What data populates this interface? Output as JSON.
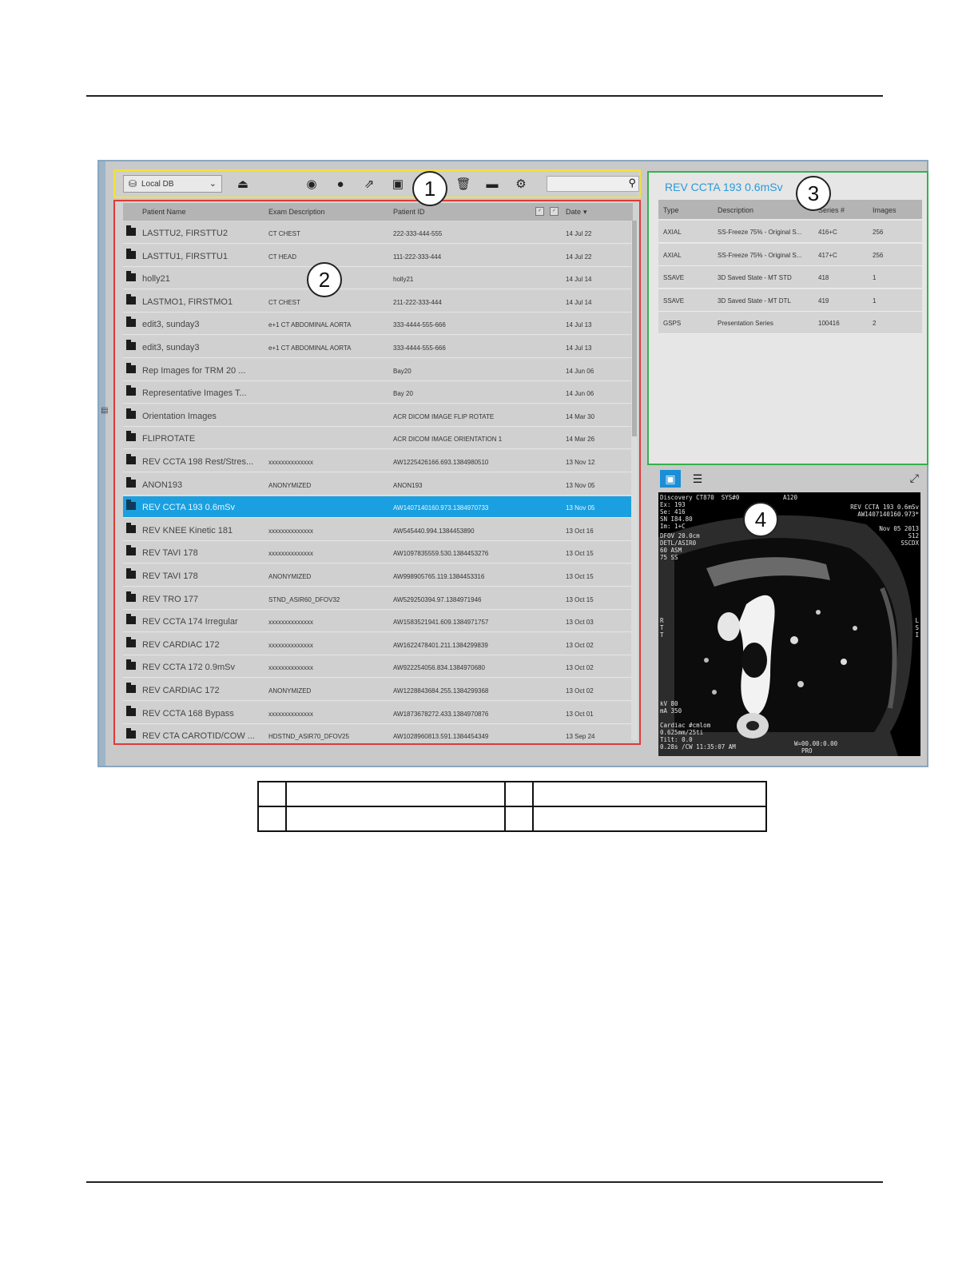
{
  "app": {
    "db_selector": "Local DB",
    "search": {
      "placeholder": ""
    }
  },
  "toolbar": {
    "icons": [
      "database-icon",
      "eject-icon",
      "review-icon",
      "query-icon",
      "export-icon",
      "archive-icon",
      "delete-icon",
      "film-icon",
      "settings-icon",
      "search-icon"
    ]
  },
  "patient_list": {
    "columns": [
      "Patient Name",
      "Exam Description",
      "Patient ID",
      "Date"
    ],
    "rows": [
      {
        "name": "LASTTU2, FIRSTTU2",
        "exam": "CT CHEST",
        "pid": "222-333-444-555",
        "date": "14 Jul 22"
      },
      {
        "name": "LASTTU1, FIRSTTU1",
        "exam": "CT HEAD",
        "pid": "111-222-333-444",
        "date": "14 Jul 22"
      },
      {
        "name": "holly21",
        "exam": "",
        "pid": "holly21",
        "date": "14 Jul 14"
      },
      {
        "name": "LASTMO1, FIRSTMO1",
        "exam": "CT CHEST",
        "pid": "211-222-333-444",
        "date": "14 Jul 14"
      },
      {
        "name": "edit3, sunday3",
        "exam": "e+1 CT ABDOMINAL AORTA",
        "pid": "333-4444-555-666",
        "date": "14 Jul 13"
      },
      {
        "name": "edit3, sunday3",
        "exam": "e+1 CT ABDOMINAL AORTA",
        "pid": "333-4444-555-666",
        "date": "14 Jul 13"
      },
      {
        "name": "Rep Images for TRM 20 ...",
        "exam": "",
        "pid": "Bay20",
        "date": "14 Jun 06"
      },
      {
        "name": "Representative Images T...",
        "exam": "",
        "pid": "Bay 20",
        "date": "14 Jun 06"
      },
      {
        "name": "Orientation Images",
        "exam": "",
        "pid": "ACR DICOM IMAGE FLIP ROTATE",
        "date": "14 Mar 30"
      },
      {
        "name": "FLIPROTATE",
        "exam": "",
        "pid": "ACR DICOM IMAGE ORIENTATION 1",
        "date": "14 Mar 26"
      },
      {
        "name": "REV CCTA 198 Rest/Stres...",
        "exam": "xxxxxxxxxxxxxx",
        "pid": "AW1225426166.693.1384980510",
        "date": "13 Nov 12"
      },
      {
        "name": "ANON193",
        "exam": "ANONYMIZED",
        "pid": "ANON193",
        "date": "13 Nov 05"
      },
      {
        "name": "REV CCTA 193 0.6mSv",
        "exam": "",
        "pid": "AW1407140160.973.1384970733",
        "date": "13 Nov 05",
        "selected": true
      },
      {
        "name": "REV KNEE Kinetic 181",
        "exam": "xxxxxxxxxxxxxx",
        "pid": "AW545440.994.1384453890",
        "date": "13 Oct 16"
      },
      {
        "name": "REV TAVI 178",
        "exam": "xxxxxxxxxxxxxx",
        "pid": "AW1097835559.530.1384453276",
        "date": "13 Oct 15"
      },
      {
        "name": "REV TAVI 178",
        "exam": "ANONYMIZED",
        "pid": "AW998905765.119.1384453316",
        "date": "13 Oct 15"
      },
      {
        "name": "REV TRO 177",
        "exam": "STND_ASIR60_DFOV32",
        "pid": "AW529250394.97.1384971946",
        "date": "13 Oct 15"
      },
      {
        "name": "REV CCTA 174 Irregular",
        "exam": "xxxxxxxxxxxxxx",
        "pid": "AW1583521941.609.1384971757",
        "date": "13 Oct 03"
      },
      {
        "name": "REV CARDIAC 172",
        "exam": "xxxxxxxxxxxxxx",
        "pid": "AW1622478401.211.1384299839",
        "date": "13 Oct 02"
      },
      {
        "name": "REV CCTA 172 0.9mSv",
        "exam": "xxxxxxxxxxxxxx",
        "pid": "AW922254056.834.1384970680",
        "date": "13 Oct 02"
      },
      {
        "name": "REV CARDIAC 172",
        "exam": "ANONYMIZED",
        "pid": "AW1228843684.255.1384299368",
        "date": "13 Oct 02"
      },
      {
        "name": "REV CCTA 168 Bypass",
        "exam": "xxxxxxxxxxxxxx",
        "pid": "AW1873678272.433.1384970876",
        "date": "13 Oct 01"
      },
      {
        "name": "REV CTA CAROTID/COW ...",
        "exam": "HDSTND_ASIR70_DFOV25",
        "pid": "AW1028960813.591.1384454349",
        "date": "13 Sep 24"
      }
    ]
  },
  "series_panel": {
    "title": "REV CCTA 193 0.6mSv",
    "columns": [
      "Type",
      "Description",
      "Series #",
      "Images"
    ],
    "rows": [
      {
        "type": "AXIAL",
        "desc": "SS-Freeze 75% - Original S...",
        "num": "416+C",
        "images": "256"
      },
      {
        "type": "AXIAL",
        "desc": "SS-Freeze 75% - Original S...",
        "num": "417+C",
        "images": "256"
      },
      {
        "type": "SSAVE",
        "desc": "3D Saved State - MT STD",
        "num": "418",
        "images": "1"
      },
      {
        "type": "SSAVE",
        "desc": "3D Saved State - MT DTL",
        "num": "419",
        "images": "1"
      },
      {
        "type": "GSPS",
        "desc": "Presentation Series",
        "num": "100416",
        "images": "2"
      }
    ]
  },
  "viewer": {
    "overlay_tl": "Discovery CT870  SYS#0\nEx: 193\nSe: 416\nSN I84.80\nIm: 1+C",
    "overlay_top": "A120",
    "overlay_tr": "REV CCTA 193 0.6mSv\nAW1407140160.973*\n\nNov 05 2013\nS12\nSSCDX",
    "overlay_ml": "DFOV 20.0cm\nDETL/ASIR0\n60 ASM\n75 SS",
    "overlay_left": "R\nT\nT",
    "overlay_right": "L\nS\nI",
    "overlay_bl": "kV 80\nmA 350\n\nCardiac #cmlom\n0.625mm/25ti\nTilt: 0.0\n0.28s /CW 11:35:07 AM",
    "overlay_br": "W=00.00:0.00\n  PRO"
  },
  "callouts": [
    "1",
    "2",
    "3",
    "4"
  ]
}
